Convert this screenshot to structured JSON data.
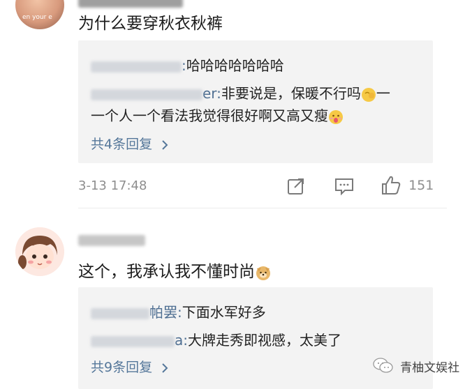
{
  "comments": [
    {
      "text": "为什么要穿秋衣秋裤",
      "avatar_text": "en your e",
      "replies": [
        {
          "name_suffix": ":",
          "text": "哈哈哈哈哈哈哈"
        },
        {
          "name_suffix": "er:",
          "text": "非要说是，保暖不行吗",
          "text2": "一个人一个看法我觉得很好啊又高又瘦"
        }
      ],
      "more_label": "共4条回复",
      "time": "3-13 17:48",
      "like_count": "151"
    },
    {
      "text": "这个，我承认我不懂时尚",
      "replies": [
        {
          "name_suffix": "帕罢:",
          "text": "下面水军好多"
        },
        {
          "name_suffix": "a:",
          "text": "大牌走秀即视感，太美了"
        }
      ],
      "more_label": "共9条回复"
    }
  ],
  "watermark": {
    "text": "青柚文娱社"
  },
  "icons": [
    "share-icon",
    "comment-icon",
    "like-icon",
    "chevron-right-icon",
    "wechat-icon"
  ]
}
